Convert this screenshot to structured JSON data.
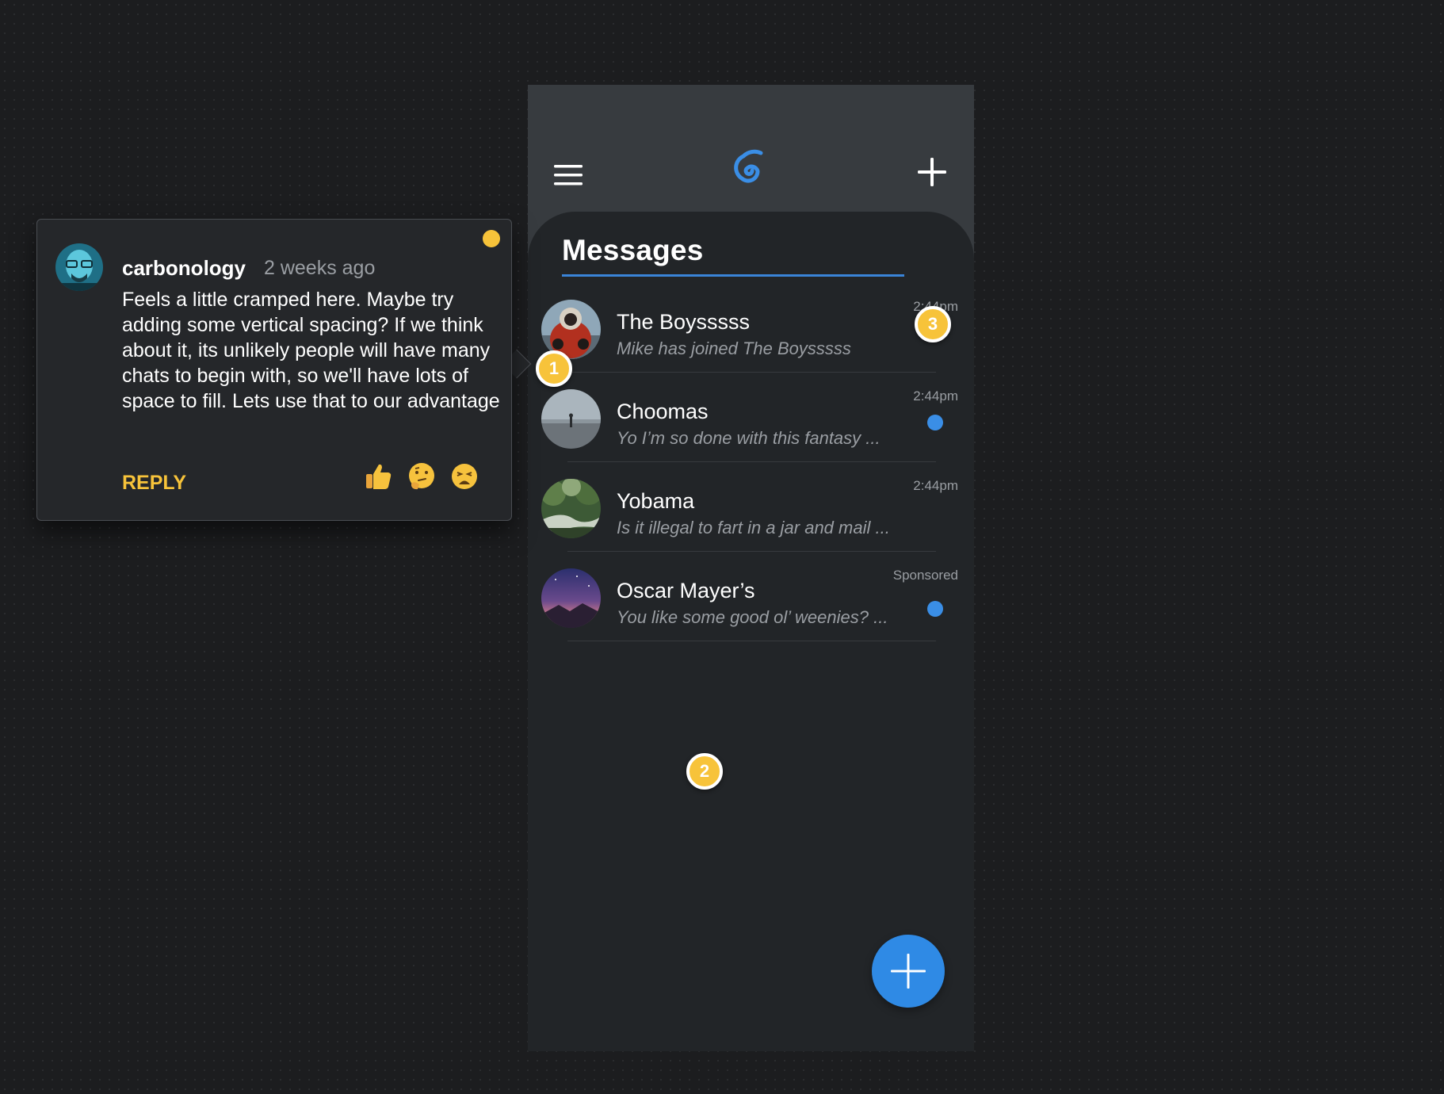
{
  "app": {
    "title": "Messages"
  },
  "chats": [
    {
      "name": "The Boysssss",
      "preview": "Mike has joined The Boysssss",
      "time": "2:44pm",
      "unread": false
    },
    {
      "name": "Choomas",
      "preview": "Yo I’m so done with this fantasy ...",
      "time": "2:44pm",
      "unread": true
    },
    {
      "name": "Yobama",
      "preview": "Is it illegal to fart in a jar and mail ...",
      "time": "2:44pm",
      "unread": false
    },
    {
      "name": "Oscar Mayer’s",
      "preview": "You like some good ol’ weenies? ...",
      "time": "Sponsored",
      "unread": true
    }
  ],
  "comment": {
    "author": "carbonology",
    "time_ago": "2 weeks ago",
    "text": "Feels a little cramped here. Maybe try adding some vertical spacing? If we think about it, its unlikely people will have many chats to begin with, so we'll have lots of space to fill. Lets use that to our advantage",
    "reply_label": "REPLY",
    "reactions": [
      "thumbs-up",
      "thinking-face",
      "weary-face"
    ]
  },
  "pins": [
    "1",
    "2",
    "3"
  ],
  "colors": {
    "accent_blue": "#2f8ae5",
    "annotation_yellow": "#f7c33a",
    "panel_dark": "#222528",
    "appbar": "#373b3f"
  },
  "icons": {
    "menu": "hamburger-icon",
    "logo": "spiral-logo-icon",
    "new": "plus-icon",
    "fab": "plus-icon"
  }
}
